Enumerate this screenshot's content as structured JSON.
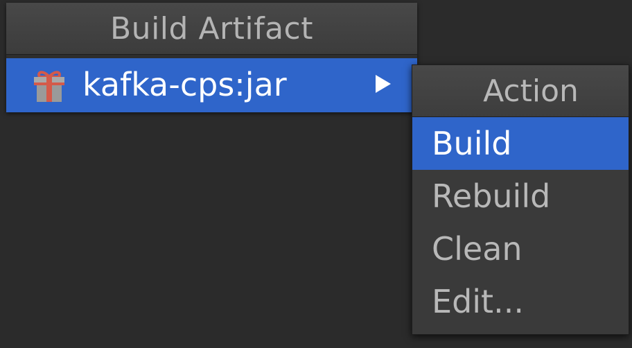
{
  "main_popup": {
    "title": "Build Artifact",
    "artifact_item": {
      "label": "kafka-cps:jar",
      "icon": "gift-icon",
      "has_submenu": true
    }
  },
  "action_popup": {
    "title": "Action",
    "items": [
      {
        "label": "Build",
        "selected": true
      },
      {
        "label": "Rebuild",
        "selected": false
      },
      {
        "label": "Clean",
        "selected": false
      },
      {
        "label": "Edit...",
        "selected": false
      }
    ]
  },
  "colors": {
    "selection": "#2f65ca",
    "background": "#2b2b2b",
    "header_text": "#b4b4b4",
    "item_text": "#b8b8b8",
    "gift_icon": "#d45a4a"
  }
}
